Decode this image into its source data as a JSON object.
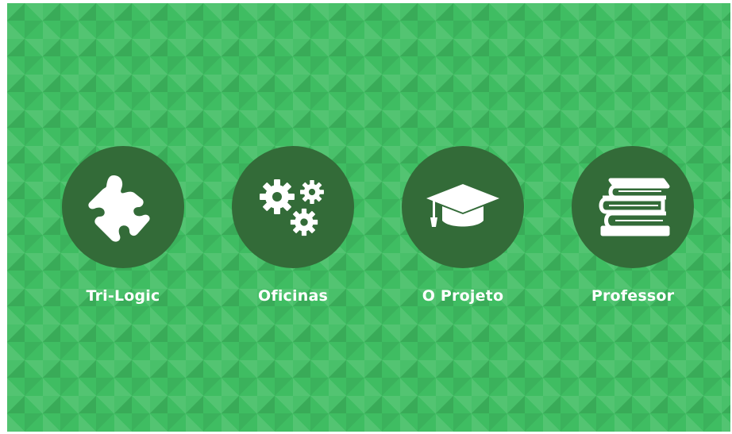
{
  "menu": {
    "items": [
      {
        "label": "Tri-Logic",
        "icon": "puzzle-piece-icon"
      },
      {
        "label": "Oficinas",
        "icon": "gears-icon"
      },
      {
        "label": "O Projeto",
        "icon": "graduation-cap-icon"
      },
      {
        "label": "Professor",
        "icon": "books-icon"
      }
    ]
  },
  "colors": {
    "background": "#3fbd62",
    "circle": "#336b38",
    "icon": "#ffffff",
    "label": "#ffffff"
  }
}
